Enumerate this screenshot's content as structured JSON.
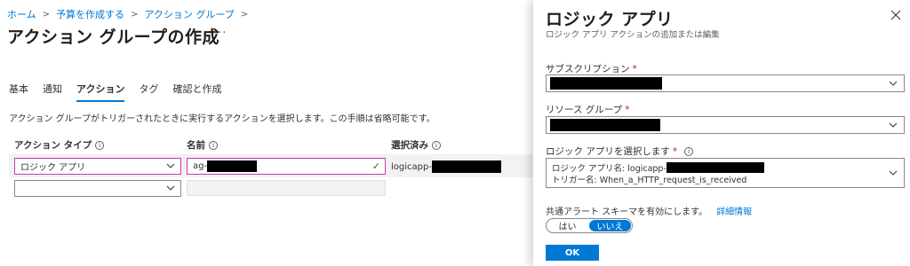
{
  "breadcrumb": [
    {
      "label": "ホーム"
    },
    {
      "label": "予算を作成する"
    },
    {
      "label": "アクション グループ"
    }
  ],
  "page": {
    "title": "アクション グループの作成",
    "more": "···"
  },
  "tabs": [
    {
      "label": "基本"
    },
    {
      "label": "通知"
    },
    {
      "label": "アクション"
    },
    {
      "label": "タグ"
    },
    {
      "label": "確認と作成"
    }
  ],
  "active_tab": "アクション",
  "description": "アクション グループがトリガーされたときに実行するアクションを選択します。この手順は省略可能です。",
  "columns": {
    "action_type": "アクション タイプ",
    "name": "名前",
    "selected": "選択済み"
  },
  "rows": [
    {
      "action_type": "ロジック アプリ",
      "name_prefix": "ag-",
      "selected_prefix": "logicapp-"
    },
    {
      "action_type": "",
      "name_prefix": "",
      "selected_prefix": ""
    }
  ],
  "icons": {
    "chevron": "chevron-down-icon",
    "info": "info-icon",
    "check": "checkmark-icon",
    "close": "close-icon"
  },
  "colors": {
    "accent": "#0078d4",
    "focus_border": "#c239b3",
    "success": "#107c10",
    "required": "#a4262c"
  },
  "panel": {
    "title": "ロジック アプリ",
    "subtitle": "ロジック アプリ アクションの追加または編集",
    "subscription_label": "サブスクリプション",
    "resource_group_label": "リソース グループ",
    "logic_app_label": "ロジック アプリを選択します",
    "required_mark": "*",
    "logic_app_name_prefix": "ロジック アプリ名: logicapp-",
    "trigger_name": "トリガー名: When_a_HTTP_request_is_received",
    "common_alert_label": "共通アラート スキーマを有効にします。",
    "details_link": "詳細情報",
    "toggle_yes": "はい",
    "toggle_no": "いいえ",
    "toggle_selected": "いいえ",
    "ok_label": "OK"
  }
}
